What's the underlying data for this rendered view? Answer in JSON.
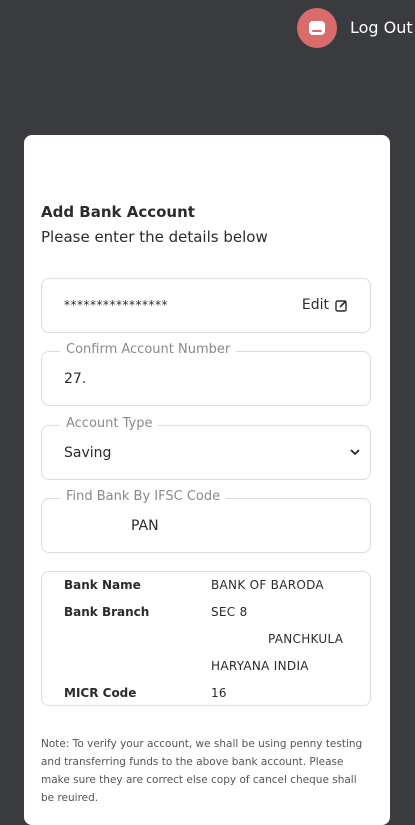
{
  "header": {
    "logout_label": "Log Out",
    "avatar_icon": "user-avatar-icon",
    "accent_color": "#d96b6b"
  },
  "form": {
    "title": "Add Bank Account",
    "subtitle": "Please enter the details below",
    "account_number": {
      "masked_value": "****************",
      "edit_label": "Edit",
      "edit_icon": "edit-icon"
    },
    "confirm_account": {
      "label": "Confirm Account Number",
      "value": "27."
    },
    "account_type": {
      "label": "Account Type",
      "selected": "Saving",
      "icon": "chevron-down-icon"
    },
    "ifsc": {
      "label": "Find Bank By IFSC Code",
      "value": "PAN"
    },
    "bank_details": {
      "bank_name_label": "Bank Name",
      "bank_name_value": "BANK OF BARODA",
      "bank_branch_label": "Bank Branch",
      "branch_line1": "SEC 8",
      "branch_line2": "PANCHKULA",
      "branch_line3": "HARYANA INDIA",
      "micr_label": "MICR Code",
      "micr_value": "16"
    },
    "note": "Note: To verify your account, we shall be using penny testing and transferring funds to the above bank account. Please make sure they are correct else copy of cancel cheque shall be reuired."
  }
}
